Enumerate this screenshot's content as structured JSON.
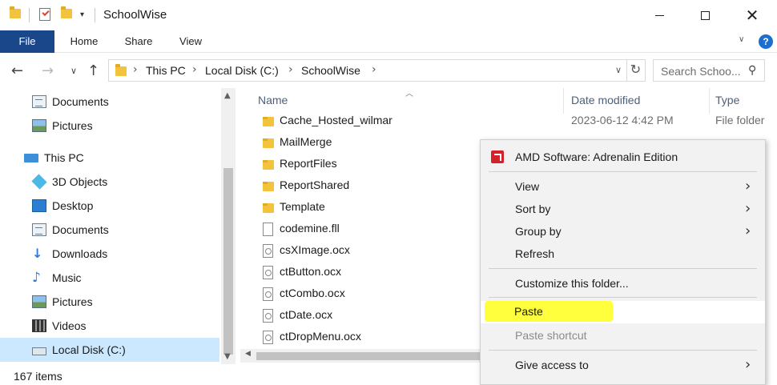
{
  "window": {
    "title": "SchoolWise",
    "minimize_icon": "minimize-icon",
    "maximize_icon": "maximize-icon",
    "close_glyph": "✕"
  },
  "ribbon": {
    "tabs": [
      "File",
      "Home",
      "Share",
      "View"
    ],
    "help_glyph": "?"
  },
  "address": {
    "crumbs": [
      "This PC",
      "Local Disk (C:)",
      "SchoolWise"
    ],
    "search_placeholder": "Search Schoo..."
  },
  "nav_pane": {
    "items": [
      {
        "label": "Documents",
        "icon": "documents-icon"
      },
      {
        "label": "Pictures",
        "icon": "pictures-icon"
      },
      {
        "label": "This PC",
        "icon": "this-pc-icon"
      },
      {
        "label": "3D Objects",
        "icon": "3d-objects-icon"
      },
      {
        "label": "Desktop",
        "icon": "desktop-icon"
      },
      {
        "label": "Documents",
        "icon": "documents-icon"
      },
      {
        "label": "Downloads",
        "icon": "downloads-icon"
      },
      {
        "label": "Music",
        "icon": "music-icon"
      },
      {
        "label": "Pictures",
        "icon": "pictures-icon"
      },
      {
        "label": "Videos",
        "icon": "videos-icon"
      },
      {
        "label": "Local Disk (C:)",
        "icon": "local-disk-icon",
        "selected": true
      }
    ]
  },
  "file_list": {
    "columns": {
      "name": "Name",
      "date": "Date modified",
      "type": "Type"
    },
    "rows": [
      {
        "name": "Cache_Hosted_wilmar",
        "date": "2023-06-12 4:42 PM",
        "type": "File folder",
        "icon": "folder-icon"
      },
      {
        "name": "MailMerge",
        "date": "",
        "type": "",
        "icon": "folder-icon"
      },
      {
        "name": "ReportFiles",
        "date": "",
        "type": "",
        "icon": "folder-icon"
      },
      {
        "name": "ReportShared",
        "date": "",
        "type": "",
        "icon": "folder-icon"
      },
      {
        "name": "Template",
        "date": "",
        "type": "",
        "icon": "folder-icon"
      },
      {
        "name": "codemine.fll",
        "date": "",
        "type": "",
        "icon": "file-icon"
      },
      {
        "name": "csXImage.ocx",
        "date": "",
        "type": "",
        "icon": "ocx-icon"
      },
      {
        "name": "ctButton.ocx",
        "date": "",
        "type": "",
        "icon": "ocx-icon"
      },
      {
        "name": "ctCombo.ocx",
        "date": "",
        "type": "",
        "icon": "ocx-icon"
      },
      {
        "name": "ctDate.ocx",
        "date": "",
        "type": "",
        "icon": "ocx-icon"
      },
      {
        "name": "ctDropMenu.ocx",
        "date": "",
        "type": "",
        "icon": "ocx-icon"
      }
    ]
  },
  "status": {
    "item_count": "167 items"
  },
  "context_menu": {
    "items": [
      {
        "label": "AMD Software: Adrenalin Edition",
        "icon": "amd-icon"
      },
      {
        "label": "View",
        "submenu": true
      },
      {
        "label": "Sort by",
        "submenu": true
      },
      {
        "label": "Group by",
        "submenu": true
      },
      {
        "label": "Refresh"
      },
      {
        "label": "Customize this folder..."
      },
      {
        "label": "Paste",
        "highlighted": true
      },
      {
        "label": "Paste shortcut",
        "disabled": true
      },
      {
        "label": "Give access to",
        "submenu": true
      }
    ],
    "highlight_color": "#ffff33"
  }
}
